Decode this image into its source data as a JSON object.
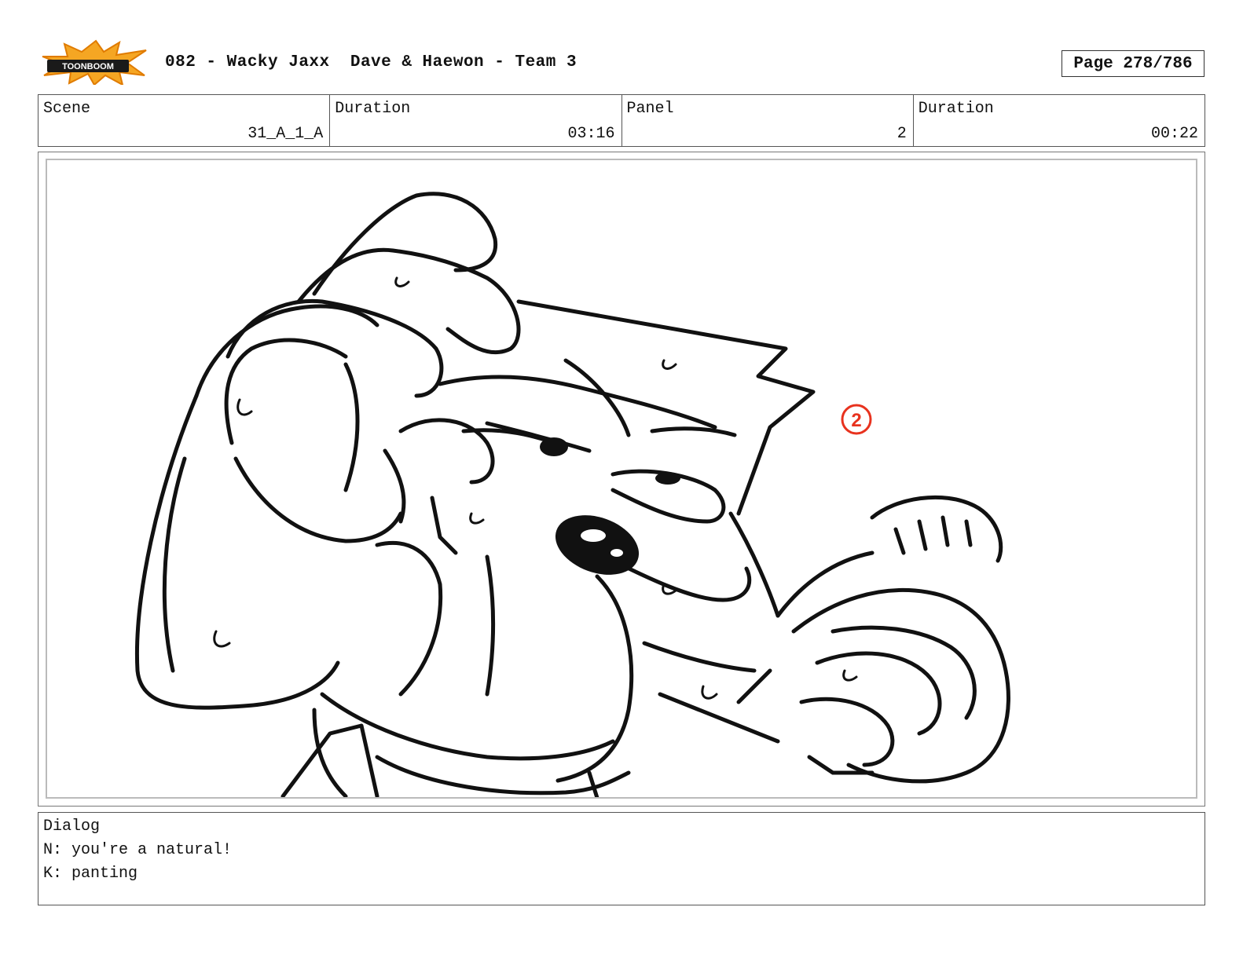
{
  "header": {
    "logo_text": "TOONBOOM",
    "title": "082 - Wacky Jaxx  Dave & Haewon - Team 3",
    "page_label": "Page 278/786"
  },
  "info": [
    {
      "label": "Scene",
      "value": "31_A_1_A"
    },
    {
      "label": "Duration",
      "value": "03:16"
    },
    {
      "label": "Panel",
      "value": "2"
    },
    {
      "label": "Duration",
      "value": "00:22"
    }
  ],
  "panel": {
    "annotation_marker": "2",
    "annotation_color": "#e8321e",
    "line_color": "#111111"
  },
  "dialog": {
    "label": "Dialog",
    "lines": [
      "N: you're a natural!",
      "K: panting"
    ]
  }
}
